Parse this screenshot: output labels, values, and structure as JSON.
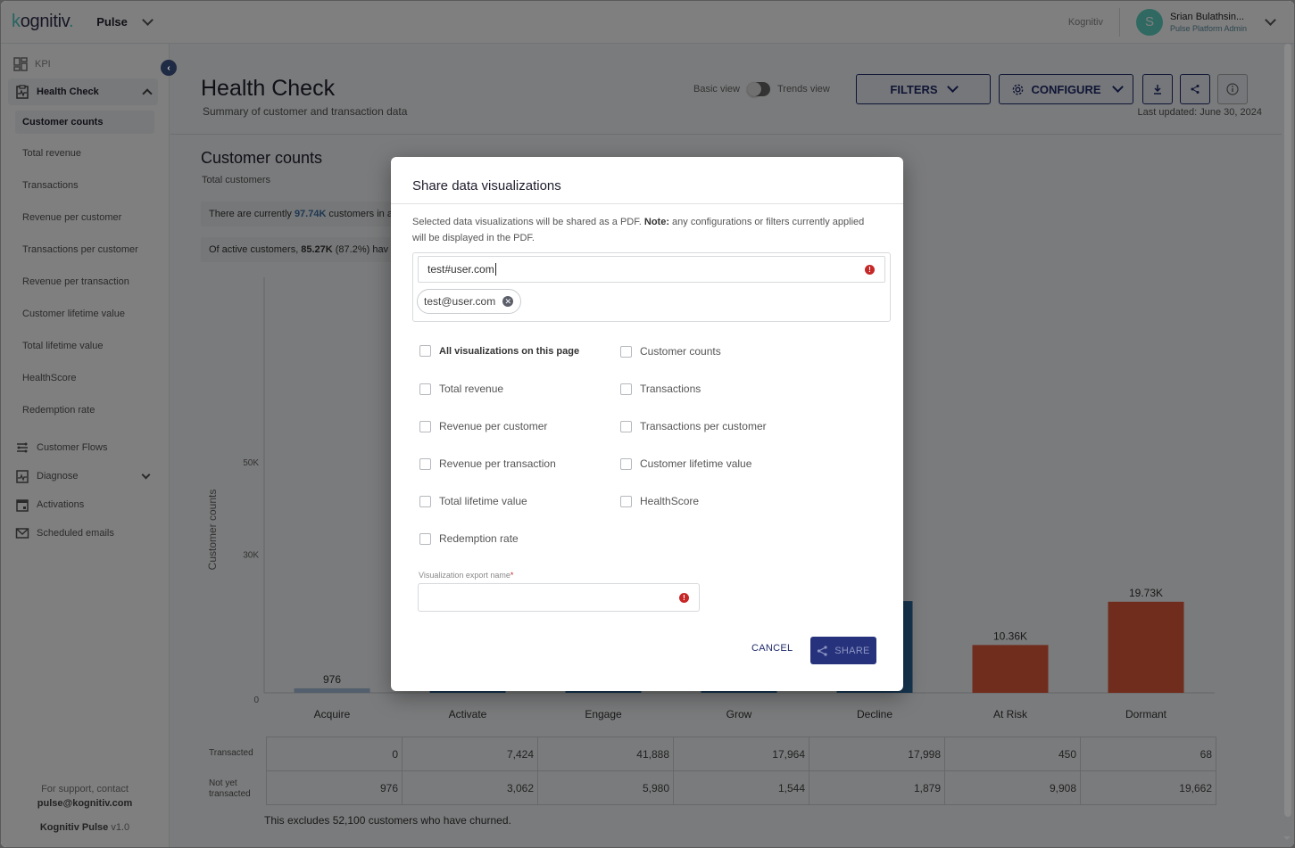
{
  "topbar": {
    "logo": "kognitiv",
    "product": "Pulse",
    "org": "Kognitiv",
    "user_initial": "S",
    "user_name": "Srian Bulathsin...",
    "user_role": "Pulse Platform Admin"
  },
  "sidebar": {
    "kpi": "KPI",
    "section": "Health Check",
    "sub_items": [
      {
        "label": "Customer counts",
        "active": true
      },
      {
        "label": "Total revenue"
      },
      {
        "label": "Transactions"
      },
      {
        "label": "Revenue per customer"
      },
      {
        "label": "Transactions per customer"
      },
      {
        "label": "Revenue per transaction"
      },
      {
        "label": "Customer lifetime value"
      },
      {
        "label": "Total lifetime value"
      },
      {
        "label": "HealthScore"
      },
      {
        "label": "Redemption rate"
      }
    ],
    "items": [
      {
        "label": "Customer Flows",
        "icon": "flows-icon"
      },
      {
        "label": "Diagnose",
        "icon": "diagnose-icon"
      },
      {
        "label": "Activations",
        "icon": "calendar-icon"
      },
      {
        "label": "Scheduled emails",
        "icon": "mail-icon"
      }
    ],
    "support_text": "For support, contact",
    "support_email": "pulse@kognitiv.com",
    "product_name": "Kognitiv Pulse",
    "version": "v1.0"
  },
  "header": {
    "title": "Health Check",
    "subtitle": "Summary of customer and transaction data",
    "toggle_left": "Basic view",
    "toggle_right": "Trends view",
    "filters": "FILTERS",
    "configure": "CONFIGURE",
    "last_updated": "Last updated: June 30, 2024"
  },
  "section": {
    "title": "Customer counts",
    "subtitle": "Total customers",
    "info1_pre": "There are currently",
    "info1_value": "97.74K",
    "info1_post": "customers in a",
    "info2_pre": "Of active customers,",
    "info2_value": "85.27K",
    "info2_post": "(87.2%) hav",
    "row_labels": [
      "Transacted",
      "Not yet transacted"
    ],
    "footnote": "This excludes 52,100 customers who have churned."
  },
  "chart_data": {
    "type": "bar",
    "title": "Customer counts",
    "ylabel": "Customer counts",
    "xlabel": "",
    "categories": [
      "Acquire",
      "Activate",
      "Engage",
      "Grow",
      "Decline",
      "At Risk",
      "Dormant"
    ],
    "values": [
      976,
      10486,
      47868,
      19508,
      19877,
      10358,
      19730
    ],
    "data_labels": [
      "976",
      "",
      "",
      "",
      "",
      "10.36K",
      "19.73K"
    ],
    "colors": [
      "#a9bfdb",
      "#2d6a9f",
      "#2d6a9f",
      "#2d6a9f",
      "#2d6a9f",
      "#e05a3a",
      "#e05a3a"
    ],
    "yticks": [
      {
        "value": 0,
        "label": "0"
      },
      {
        "value": 30000,
        "label": "30K"
      },
      {
        "value": 50000,
        "label": "50K"
      }
    ],
    "ylim": [
      0,
      90000
    ],
    "grid": false,
    "table": {
      "rows": [
        {
          "label": "Transacted",
          "values": [
            "0",
            "7,424",
            "41,888",
            "17,964",
            "17,998",
            "450",
            "68"
          ]
        },
        {
          "label": "Not yet transacted",
          "values": [
            "976",
            "3,062",
            "5,980",
            "1,544",
            "1,879",
            "9,908",
            "19,662"
          ]
        }
      ]
    }
  },
  "modal": {
    "title": "Share data visualizations",
    "desc_pre": "Selected data visualizations will be shared as a PDF.",
    "desc_note": "Note:",
    "desc_post": "any configurations or filters currently applied will be displayed in the PDF.",
    "email_input_value": "test#user.com",
    "email_chip": "test@user.com",
    "checkboxes_left": [
      "All visualizations on this page",
      "Total revenue",
      "Revenue per customer",
      "Revenue per transaction",
      "Total lifetime value",
      "Redemption rate"
    ],
    "checkboxes_right": [
      "Customer counts",
      "Transactions",
      "Transactions per customer",
      "Customer lifetime value",
      "HealthScore"
    ],
    "export_label": "Visualization export name",
    "export_required": "*",
    "export_value": "",
    "cancel": "CANCEL",
    "share": "SHARE"
  }
}
